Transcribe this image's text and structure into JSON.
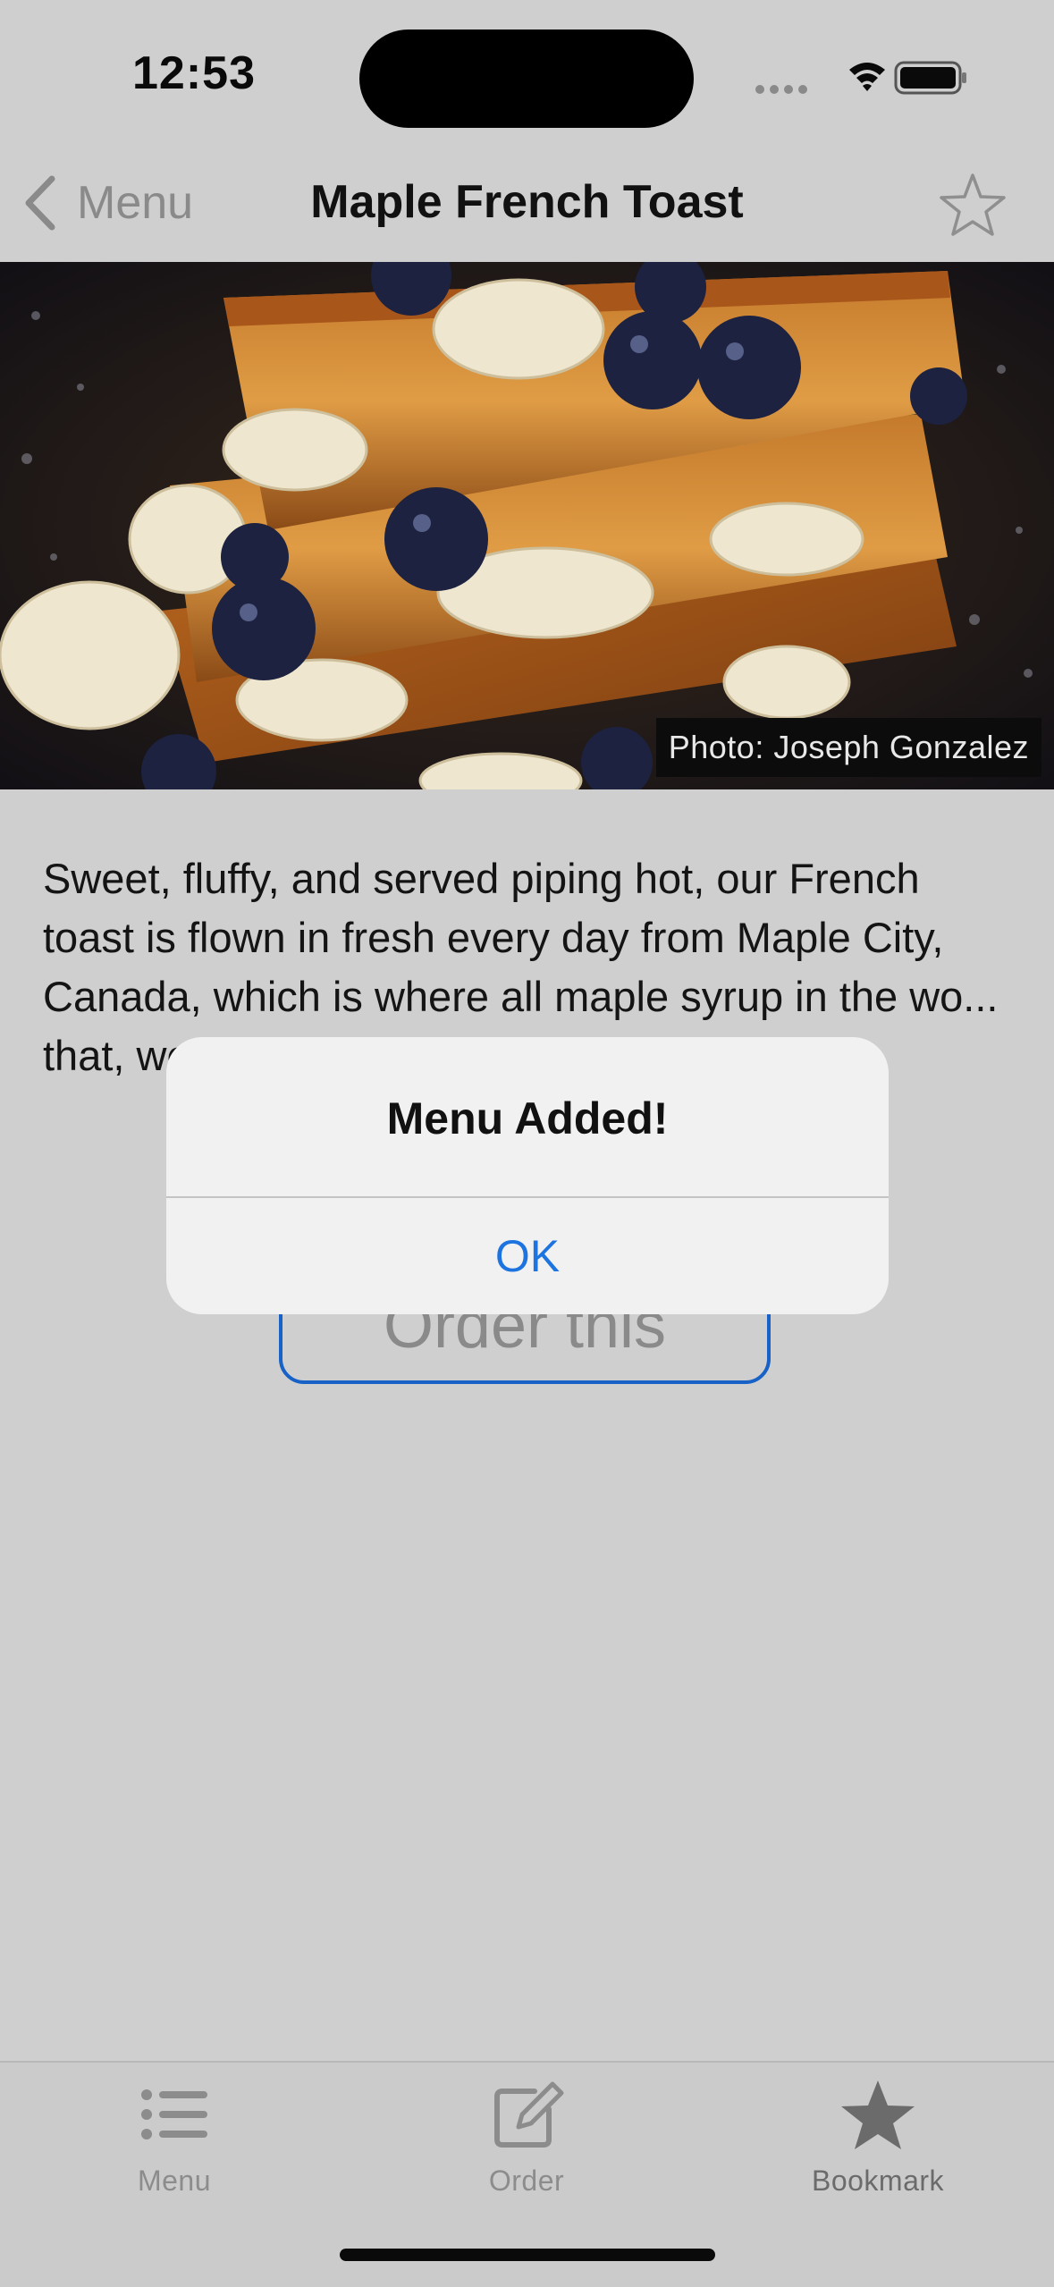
{
  "status": {
    "time": "12:53"
  },
  "nav": {
    "back_label": "Menu",
    "title": "Maple French Toast",
    "icons": [
      "chevron-left-icon",
      "star-outline-icon"
    ]
  },
  "hero": {
    "credit": "Photo: Joseph Gonzalez"
  },
  "description": "Sweet, fluffy, and served piping hot, our French toast is flown in fresh every day from Maple City, Canada, which is where all maple syrup in the wo... that, we hav...",
  "order_button": {
    "label": "Order this"
  },
  "alert": {
    "title": "Menu Added!",
    "ok_label": "OK"
  },
  "tabs": [
    {
      "label": "Menu",
      "icon": "list-icon"
    },
    {
      "label": "Order",
      "icon": "compose-icon"
    },
    {
      "label": "Bookmark",
      "icon": "star-filled-icon"
    }
  ],
  "colors": {
    "accent": "#1d74e0",
    "button_border": "#1761c7",
    "background": "#cfcfcf"
  }
}
